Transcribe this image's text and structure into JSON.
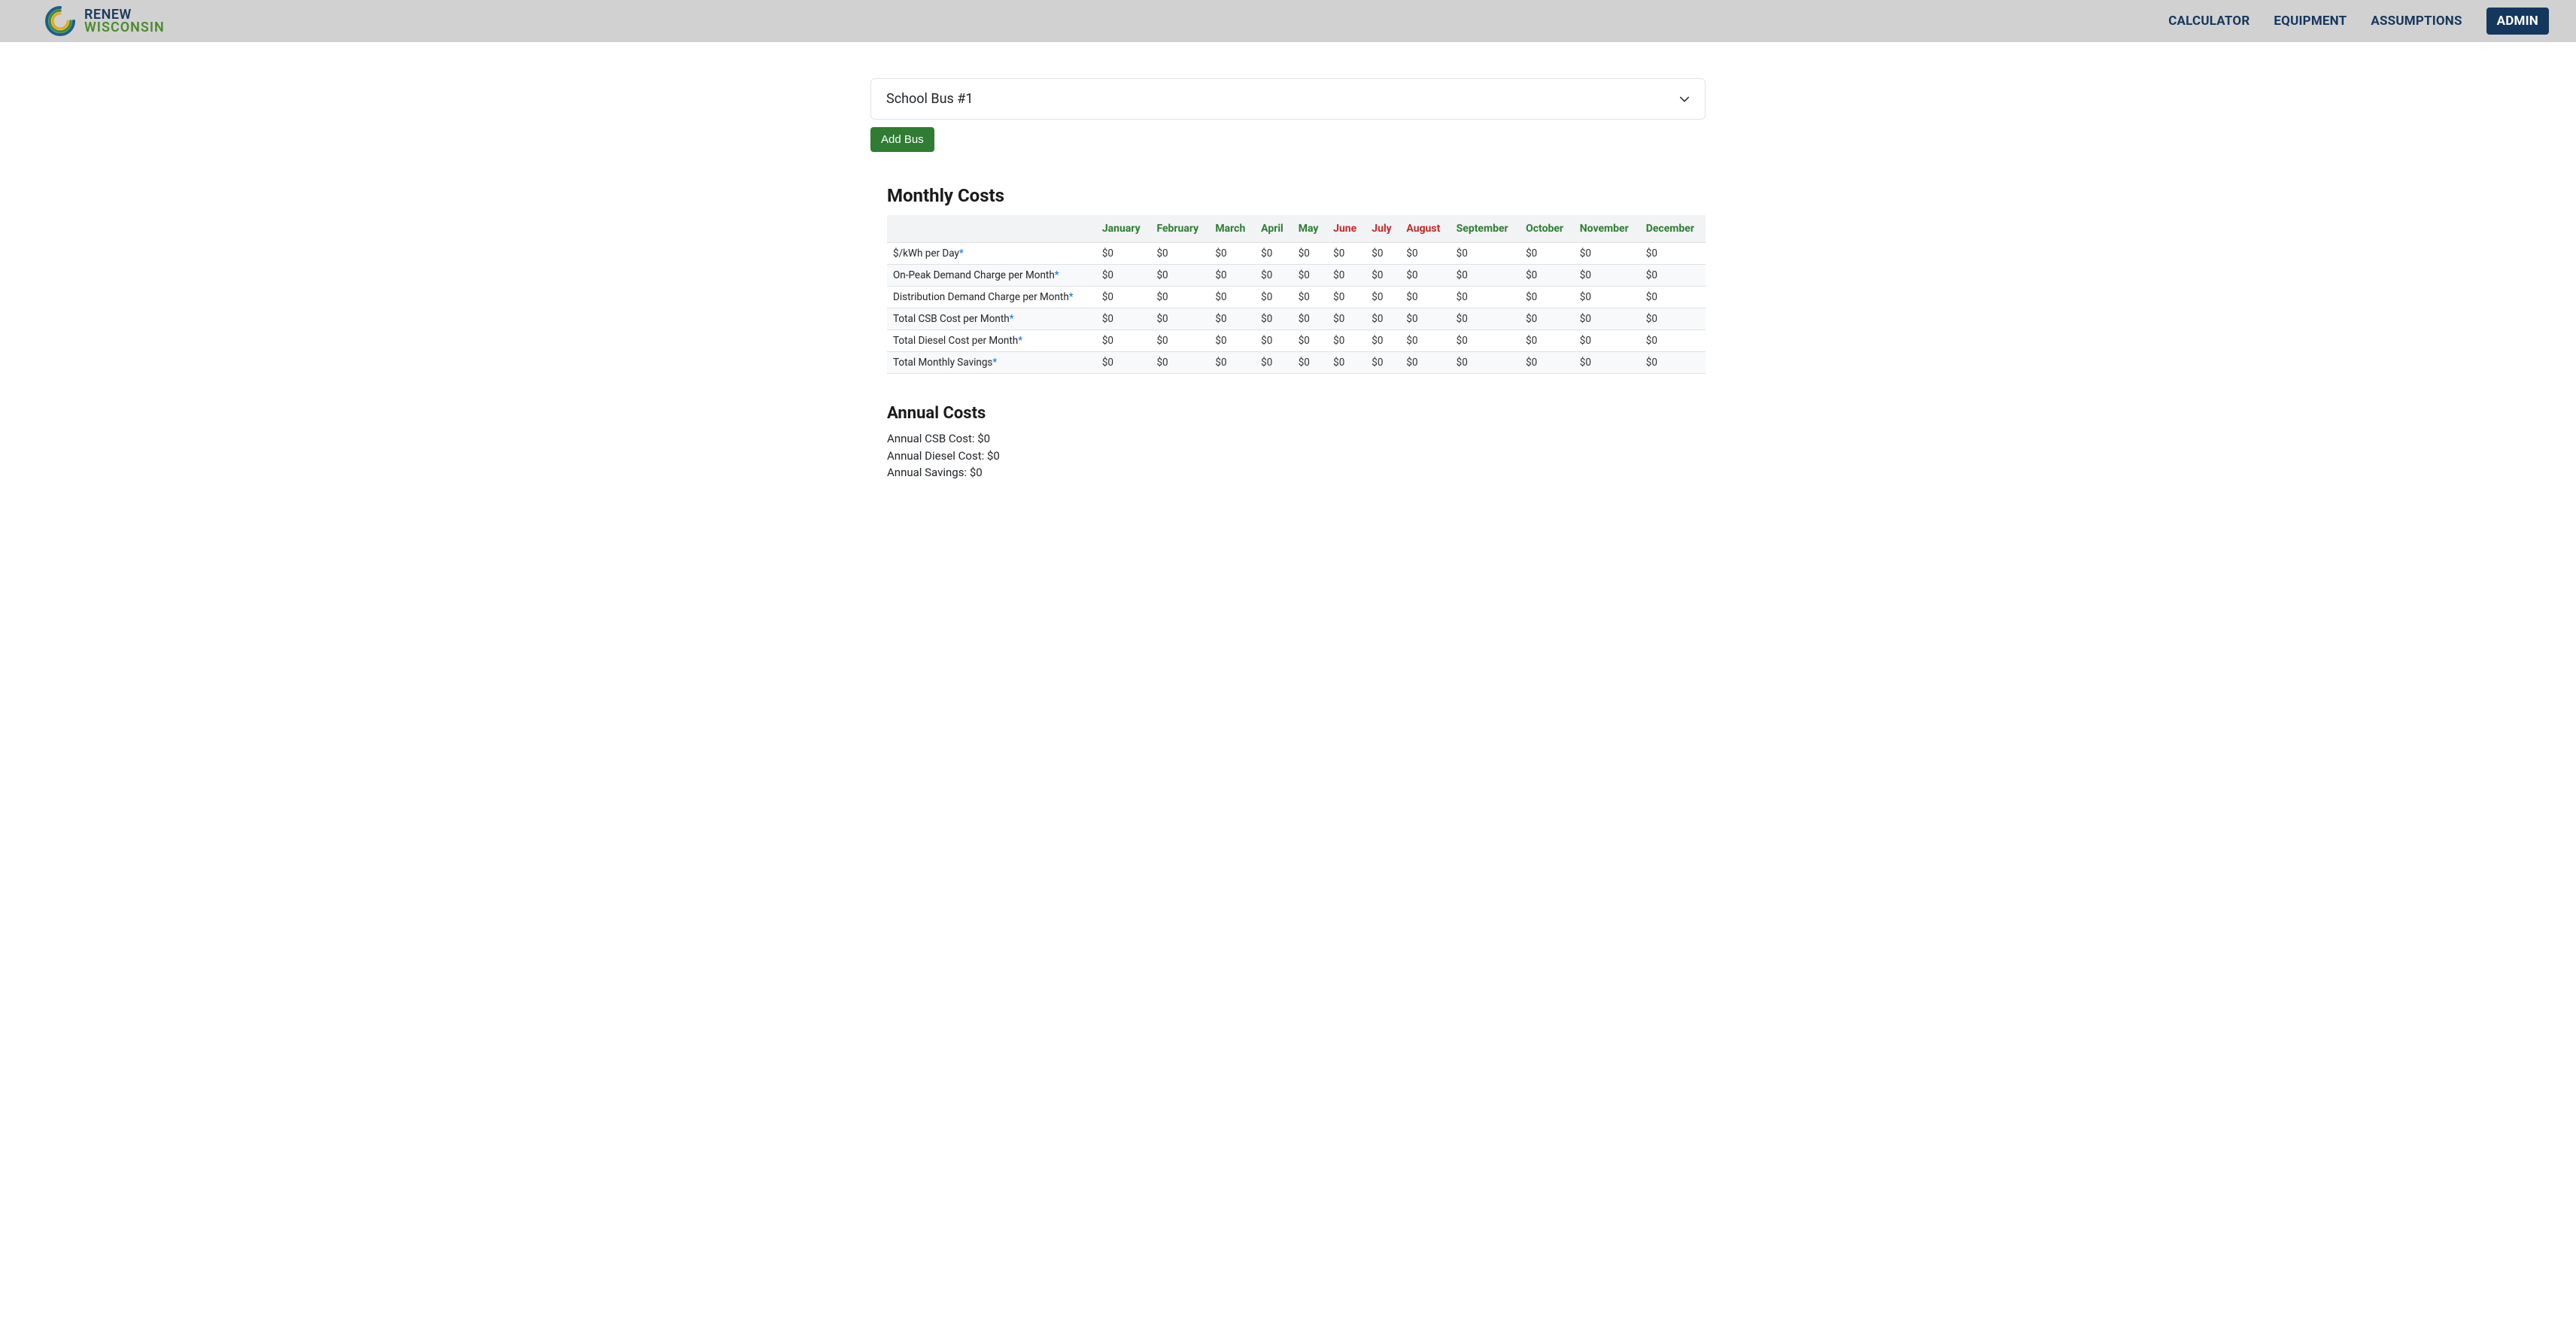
{
  "header": {
    "logo_top": "RENEW",
    "logo_bottom": "WISCONSIN",
    "nav": {
      "calculator": "CALCULATOR",
      "equipment": "EQUIPMENT",
      "assumptions": "ASSUMPTIONS",
      "admin": "ADMIN"
    }
  },
  "accordion": {
    "title": "School Bus #1"
  },
  "buttons": {
    "add_bus": "Add Bus"
  },
  "monthly_costs": {
    "title": "Monthly Costs",
    "months": [
      {
        "label": "January",
        "summer": false
      },
      {
        "label": "February",
        "summer": false
      },
      {
        "label": "March",
        "summer": false
      },
      {
        "label": "April",
        "summer": false
      },
      {
        "label": "May",
        "summer": false
      },
      {
        "label": "June",
        "summer": true
      },
      {
        "label": "July",
        "summer": true
      },
      {
        "label": "August",
        "summer": true
      },
      {
        "label": "September",
        "summer": false
      },
      {
        "label": "October",
        "summer": false
      },
      {
        "label": "November",
        "summer": false
      },
      {
        "label": "December",
        "summer": false
      }
    ],
    "rows": [
      {
        "label": "$/kWh per Day",
        "has_asterisk": true,
        "values": [
          "$0",
          "$0",
          "$0",
          "$0",
          "$0",
          "$0",
          "$0",
          "$0",
          "$0",
          "$0",
          "$0",
          "$0"
        ]
      },
      {
        "label": "On-Peak Demand Charge per Month",
        "has_asterisk": true,
        "values": [
          "$0",
          "$0",
          "$0",
          "$0",
          "$0",
          "$0",
          "$0",
          "$0",
          "$0",
          "$0",
          "$0",
          "$0"
        ]
      },
      {
        "label": "Distribution Demand Charge per Month",
        "has_asterisk": true,
        "values": [
          "$0",
          "$0",
          "$0",
          "$0",
          "$0",
          "$0",
          "$0",
          "$0",
          "$0",
          "$0",
          "$0",
          "$0"
        ]
      },
      {
        "label": "Total CSB Cost per Month",
        "has_asterisk": true,
        "values": [
          "$0",
          "$0",
          "$0",
          "$0",
          "$0",
          "$0",
          "$0",
          "$0",
          "$0",
          "$0",
          "$0",
          "$0"
        ]
      },
      {
        "label": "Total Diesel Cost per Month",
        "has_asterisk": true,
        "values": [
          "$0",
          "$0",
          "$0",
          "$0",
          "$0",
          "$0",
          "$0",
          "$0",
          "$0",
          "$0",
          "$0",
          "$0"
        ]
      },
      {
        "label": "Total Monthly Savings",
        "has_asterisk": true,
        "values": [
          "$0",
          "$0",
          "$0",
          "$0",
          "$0",
          "$0",
          "$0",
          "$0",
          "$0",
          "$0",
          "$0",
          "$0"
        ]
      }
    ]
  },
  "annual_costs": {
    "title": "Annual Costs",
    "csb_label": "Annual CSB Cost: ",
    "csb_value": "$0",
    "diesel_label": "Annual Diesel Cost: ",
    "diesel_value": "$0",
    "savings_label": "Annual Savings: ",
    "savings_value": "$0"
  }
}
